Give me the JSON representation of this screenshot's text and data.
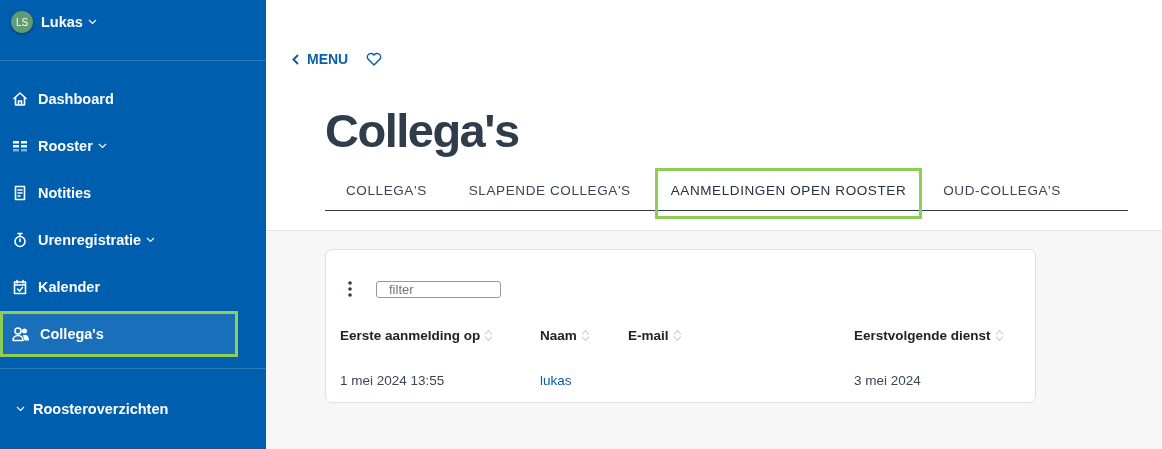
{
  "user": {
    "initials": "LS",
    "name": "Lukas"
  },
  "sidebar": {
    "items": [
      {
        "kind": "home",
        "label": "Dashboard",
        "has_menu": false,
        "selected": false,
        "highlighted": false
      },
      {
        "kind": "grid",
        "label": "Rooster",
        "has_menu": true,
        "selected": false,
        "highlighted": false
      },
      {
        "kind": "note",
        "label": "Notities",
        "has_menu": false,
        "selected": false,
        "highlighted": false
      },
      {
        "kind": "timer",
        "label": "Urenregistratie",
        "has_menu": true,
        "selected": false,
        "highlighted": false
      },
      {
        "kind": "calendar",
        "label": "Kalender",
        "has_menu": false,
        "selected": false,
        "highlighted": false
      },
      {
        "kind": "people",
        "label": "Collega's",
        "has_menu": false,
        "selected": true,
        "highlighted": true
      }
    ],
    "section": {
      "label": "Roosteroverzichten",
      "expanded": true
    }
  },
  "back_link": "MENU",
  "title": "Collega's",
  "tabs": [
    {
      "label": "COLLEGA'S",
      "selected": false,
      "highlighted": false
    },
    {
      "label": "SLAPENDE COLLEGA'S",
      "selected": false,
      "highlighted": false
    },
    {
      "label": "AANMELDINGEN OPEN ROOSTER",
      "selected": true,
      "highlighted": true
    },
    {
      "label": "OUD-COLLEGA'S",
      "selected": false,
      "highlighted": false
    }
  ],
  "filter": {
    "placeholder": "filter"
  },
  "table": {
    "columns": [
      "Eerste aanmelding op",
      "Naam",
      "E-mail",
      "Eerstvolgende dienst"
    ],
    "rows": [
      {
        "cells": [
          "1 mei 2024 13:55",
          "lukas",
          "",
          "3 mei 2024"
        ]
      }
    ]
  }
}
